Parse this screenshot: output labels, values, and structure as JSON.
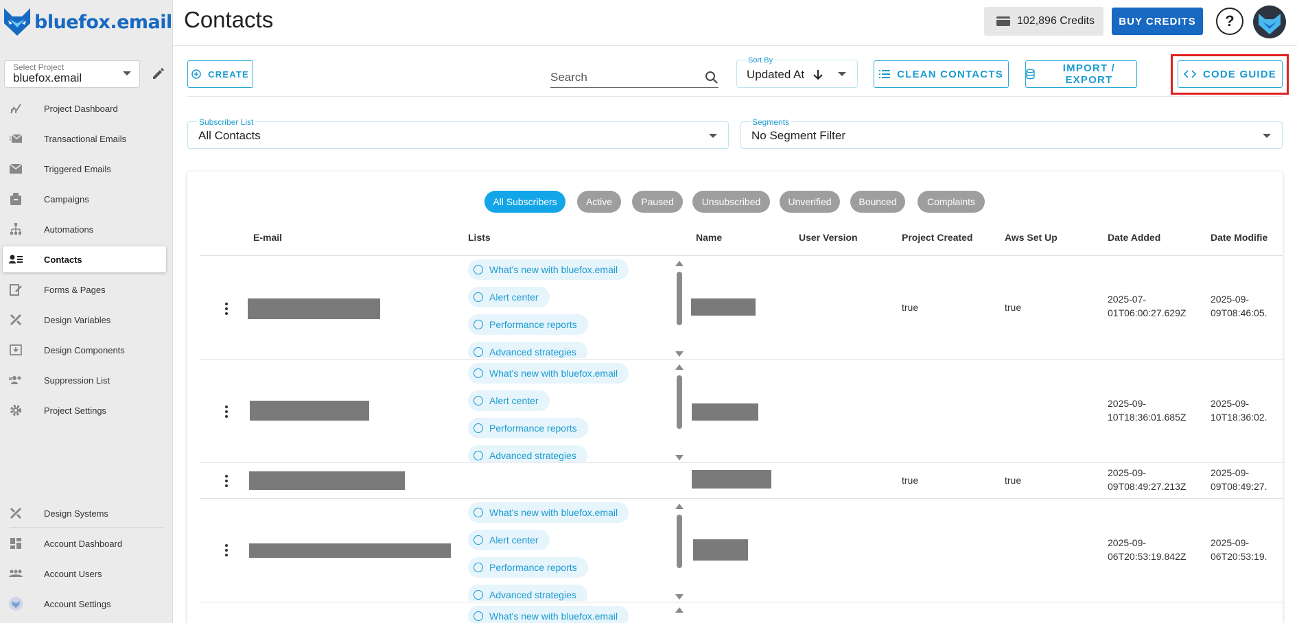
{
  "sidebar": {
    "logo_text": "bluefox.email",
    "project_label": "Select Project",
    "project_value": "bluefox.email",
    "nav_items": [
      {
        "label": "Project Dashboard",
        "icon": "chart-icon"
      },
      {
        "label": "Transactional Emails",
        "icon": "send-mail-icon"
      },
      {
        "label": "Triggered Emails",
        "icon": "mail-icon"
      },
      {
        "label": "Campaigns",
        "icon": "campaign-icon"
      },
      {
        "label": "Automations",
        "icon": "automation-icon"
      },
      {
        "label": "Contacts",
        "icon": "contacts-icon",
        "active": true
      },
      {
        "label": "Forms & Pages",
        "icon": "forms-icon"
      },
      {
        "label": "Design Variables",
        "icon": "design-tools-icon"
      },
      {
        "label": "Design Components",
        "icon": "component-icon"
      },
      {
        "label": "Suppression List",
        "icon": "suppression-icon"
      },
      {
        "label": "Project Settings",
        "icon": "gear-icon"
      }
    ],
    "bottom_items": [
      {
        "label": "Design Systems",
        "icon": "design-tools-icon"
      },
      {
        "label": "Account Dashboard",
        "icon": "dashboard-icon"
      },
      {
        "label": "Account Users",
        "icon": "users-icon"
      },
      {
        "label": "Account Settings",
        "icon": "account-settings-icon"
      }
    ]
  },
  "header": {
    "title": "Contacts",
    "credits": "102,896 Credits",
    "buy_credits": "BUY CREDITS",
    "help": "?"
  },
  "toolbar": {
    "create": "CREATE",
    "search_placeholder": "Search",
    "sort_label": "Sort By",
    "sort_value": "Updated At",
    "clean_contacts": "CLEAN CONTACTS",
    "import_export": "IMPORT / EXPORT",
    "code_guide": "CODE GUIDE"
  },
  "filters": {
    "subscriber_list_label": "Subscriber List",
    "subscriber_list_value": "All Contacts",
    "segments_label": "Segments",
    "segments_value": "No Segment Filter"
  },
  "status_chips": [
    "All Subscribers",
    "Active",
    "Paused",
    "Unsubscribed",
    "Unverified",
    "Bounced",
    "Complaints"
  ],
  "table": {
    "headers": [
      "E-mail",
      "Lists",
      "Name",
      "User Version",
      "Project Created",
      "Aws Set Up",
      "Date Added",
      "Date Modifie"
    ],
    "list_names": [
      "What's new with bluefox.email",
      "Alert center",
      "Performance reports",
      "Advanced strategies"
    ],
    "rows": [
      {
        "project_created": "true",
        "aws_set_up": "true",
        "date_added_1": "2025-07-",
        "date_added_2": "01T06:00:27.629Z",
        "date_mod_1": "2025-09-",
        "date_mod_2": "09T08:46:05."
      },
      {
        "project_created": "",
        "aws_set_up": "",
        "date_added_1": "2025-09-",
        "date_added_2": "10T18:36:01.685Z",
        "date_mod_1": "2025-09-",
        "date_mod_2": "10T18:36:02."
      },
      {
        "project_created": "true",
        "aws_set_up": "true",
        "date_added_1": "2025-09-",
        "date_added_2": "09T08:49:27.213Z",
        "date_mod_1": "2025-09-",
        "date_mod_2": "09T08:49:27."
      },
      {
        "project_created": "",
        "aws_set_up": "",
        "date_added_1": "2025-09-",
        "date_added_2": "06T20:53:19.842Z",
        "date_mod_1": "2025-09-",
        "date_mod_2": "06T20:53:19."
      }
    ]
  },
  "colors": {
    "brand": "#1769c2",
    "accent": "#1a9bd2",
    "highlight": "#e02020"
  }
}
